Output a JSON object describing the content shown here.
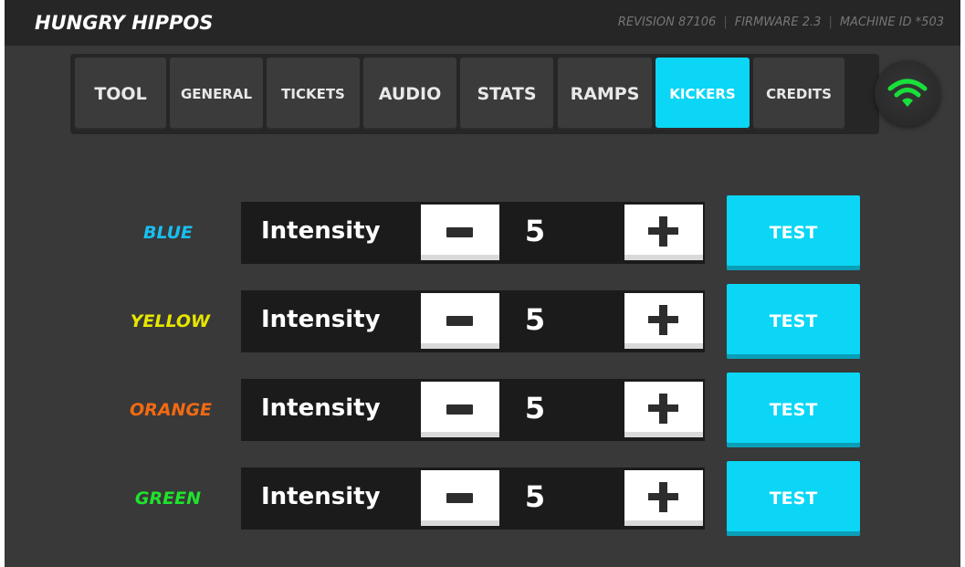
{
  "header": {
    "title": "HUNGRY HIPPOS",
    "revision": "REVISION 87106",
    "firmware": "FIRMWARE 2.3",
    "machine_id": "MACHINE ID *503"
  },
  "tabs": [
    {
      "label": "TOOL"
    },
    {
      "label": "GENERAL"
    },
    {
      "label": "TICKETS"
    },
    {
      "label": "AUDIO"
    },
    {
      "label": "STATS"
    },
    {
      "label": "RAMPS"
    },
    {
      "label": "KICKERS",
      "active": true
    },
    {
      "label": "CREDITS"
    }
  ],
  "wifi": {
    "icon": "wifi-icon",
    "color": "#18e03a"
  },
  "accent_color": "#0bd6f5",
  "kickers": [
    {
      "name": "BLUE",
      "color": "#18bff0",
      "control_label": "Intensity",
      "value": "5",
      "test_label": "TEST"
    },
    {
      "name": "YELLOW",
      "color": "#e6e600",
      "control_label": "Intensity",
      "value": "5",
      "test_label": "TEST"
    },
    {
      "name": "ORANGE",
      "color": "#f26a12",
      "control_label": "Intensity",
      "value": "5",
      "test_label": "TEST"
    },
    {
      "name": "GREEN",
      "color": "#1ee32d",
      "control_label": "Intensity",
      "value": "5",
      "test_label": "TEST"
    }
  ]
}
